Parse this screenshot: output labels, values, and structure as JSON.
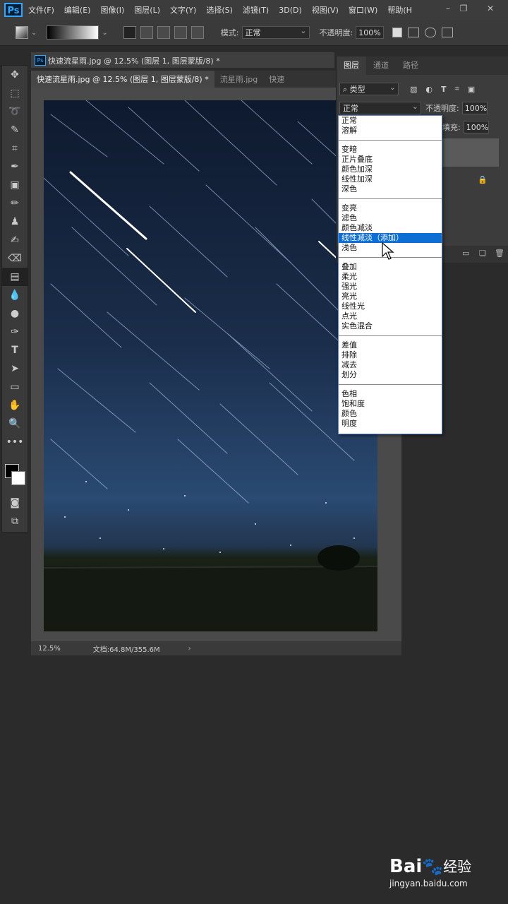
{
  "app": {
    "logo": "Ps"
  },
  "menu": [
    "文件(F)",
    "编辑(E)",
    "图像(I)",
    "图层(L)",
    "文字(Y)",
    "选择(S)",
    "滤镜(T)",
    "3D(D)",
    "视图(V)",
    "窗口(W)",
    "帮助(H"
  ],
  "options": {
    "mode_label": "模式:",
    "mode_value": "正常",
    "opacity_label": "不透明度:",
    "opacity_value": "100%"
  },
  "document": {
    "tab_active": "快速流星雨.jpg @ 12.5% (图层 1, 图层蒙版/8) *",
    "tab_2": "流星雨.jpg",
    "tab_3": "快速",
    "header_title": "快速流星雨.jpg @ 12.5% (图层 1, 图层蒙版/8) *",
    "zoom": "12.5%",
    "doc_size": "文档:64.8M/355.6M"
  },
  "layers_panel": {
    "tabs": [
      "图层",
      "通道",
      "路径"
    ],
    "filter_kind": "类型",
    "blend_mode": "正常",
    "opacity_label": "不透明度:",
    "opacity_value": "100%",
    "fill_label": "填充:",
    "fill_value": "100%"
  },
  "blend_dropdown": {
    "groups": [
      [
        "正常",
        "溶解"
      ],
      [
        "变暗",
        "正片叠底",
        "颜色加深",
        "线性加深",
        "深色"
      ],
      [
        "变亮",
        "滤色",
        "颜色减淡",
        "线性减淡（添加）",
        "浅色"
      ],
      [
        "叠加",
        "柔光",
        "强光",
        "亮光",
        "线性光",
        "点光",
        "实色混合"
      ],
      [
        "差值",
        "排除",
        "减去",
        "划分"
      ],
      [
        "色相",
        "饱和度",
        "颜色",
        "明度"
      ]
    ],
    "selected": "线性减淡（添加）"
  },
  "watermark": {
    "brand": "Bai",
    "brand_suffix": "经验",
    "url": "jingyan.baidu.com"
  },
  "colors": {
    "accent": "#31a8ff",
    "selection": "#0d6ed6"
  }
}
